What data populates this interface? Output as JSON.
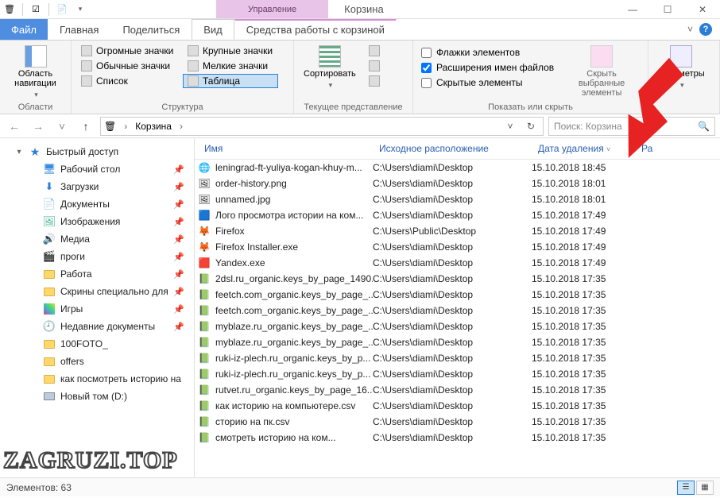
{
  "window": {
    "title": "Корзина",
    "context_tab_header": "Управление"
  },
  "file_tab": "Файл",
  "tabs": {
    "home": "Главная",
    "share": "Поделиться",
    "view": "Вид",
    "tool": "Средства работы с корзиной"
  },
  "ribbon": {
    "panes": {
      "label": "Области",
      "nav": "Область навигации"
    },
    "layout": {
      "label": "Структура",
      "huge": "Огромные значки",
      "large": "Крупные значки",
      "medium": "Обычные значки",
      "small": "Мелкие значки",
      "list": "Список",
      "details": "Таблица"
    },
    "current": {
      "label": "Текущее представление",
      "sort": "Сортировать"
    },
    "showhide": {
      "label": "Показать или скрыть",
      "checkboxes": "Флажки элементов",
      "extensions": "Расширения имен файлов",
      "hidden": "Скрытые элементы",
      "hideSelected": "Скрыть выбранные элементы"
    },
    "options": "Параметры"
  },
  "breadcrumb": {
    "root": "Корзина"
  },
  "search": {
    "placeholder": "Поиск: Корзина"
  },
  "sidebar": {
    "quick": "Быстрый доступ",
    "items": [
      {
        "label": "Рабочий стол",
        "icon": "desktop",
        "pin": true
      },
      {
        "label": "Загрузки",
        "icon": "down",
        "pin": true
      },
      {
        "label": "Документы",
        "icon": "doc",
        "pin": true
      },
      {
        "label": "Изображения",
        "icon": "img",
        "pin": true
      },
      {
        "label": "Медиа",
        "icon": "media",
        "pin": true
      },
      {
        "label": "проги",
        "icon": "film",
        "pin": true
      },
      {
        "label": "Работа",
        "icon": "folder",
        "pin": true
      },
      {
        "label": "Скрины специально для ",
        "icon": "folder",
        "pin": true
      },
      {
        "label": "Игры",
        "icon": "games",
        "pin": true
      },
      {
        "label": "Недавние документы",
        "icon": "clock",
        "pin": true
      },
      {
        "label": "100FOTO_",
        "icon": "folder",
        "pin": false
      },
      {
        "label": "offers",
        "icon": "folder",
        "pin": false
      },
      {
        "label": "как посмотреть историю на",
        "icon": "folder",
        "pin": false
      },
      {
        "label": "Новый том (D:)",
        "icon": "drive",
        "pin": false
      }
    ]
  },
  "columns": {
    "name": "Имя",
    "orig": "Исходное расположение",
    "date": "Дата удаления",
    "size": "Ра"
  },
  "files": [
    {
      "name": "leningrad-ft-yuliya-kogan-khuy-m...",
      "icon": "web",
      "orig": "C:\\Users\\diami\\Desktop",
      "date": "15.10.2018 18:45"
    },
    {
      "name": "order-history.png",
      "icon": "png",
      "orig": "C:\\Users\\diami\\Desktop",
      "date": "15.10.2018 18:01"
    },
    {
      "name": "unnamed.jpg",
      "icon": "png",
      "orig": "C:\\Users\\diami\\Desktop",
      "date": "15.10.2018 18:01"
    },
    {
      "name": "Лого просмотра истории на ком...",
      "icon": "psd",
      "orig": "C:\\Users\\diami\\Desktop",
      "date": "15.10.2018 17:49"
    },
    {
      "name": "Firefox",
      "icon": "ff",
      "orig": "C:\\Users\\Public\\Desktop",
      "date": "15.10.2018 17:49"
    },
    {
      "name": "Firefox Installer.exe",
      "icon": "ff",
      "orig": "C:\\Users\\diami\\Desktop",
      "date": "15.10.2018 17:49"
    },
    {
      "name": "Yandex.exe",
      "icon": "ya",
      "orig": "C:\\Users\\diami\\Desktop",
      "date": "15.10.2018 17:49"
    },
    {
      "name": "2dsl.ru_organic.keys_by_page_1490...",
      "icon": "xls",
      "orig": "C:\\Users\\diami\\Desktop",
      "date": "15.10.2018 17:35"
    },
    {
      "name": "feetch.com_organic.keys_by_page_...",
      "icon": "xls",
      "orig": "C:\\Users\\diami\\Desktop",
      "date": "15.10.2018 17:35"
    },
    {
      "name": "feetch.com_organic.keys_by_page_...",
      "icon": "xls",
      "orig": "C:\\Users\\diami\\Desktop",
      "date": "15.10.2018 17:35"
    },
    {
      "name": "myblaze.ru_organic.keys_by_page_...",
      "icon": "xls",
      "orig": "C:\\Users\\diami\\Desktop",
      "date": "15.10.2018 17:35"
    },
    {
      "name": "myblaze.ru_organic.keys_by_page_...",
      "icon": "xls",
      "orig": "C:\\Users\\diami\\Desktop",
      "date": "15.10.2018 17:35"
    },
    {
      "name": "ruki-iz-plech.ru_organic.keys_by_p...",
      "icon": "xls",
      "orig": "C:\\Users\\diami\\Desktop",
      "date": "15.10.2018 17:35"
    },
    {
      "name": "ruki-iz-plech.ru_organic.keys_by_p...",
      "icon": "xls",
      "orig": "C:\\Users\\diami\\Desktop",
      "date": "15.10.2018 17:35"
    },
    {
      "name": "rutvet.ru_organic.keys_by_page_16...",
      "icon": "xls",
      "orig": "C:\\Users\\diami\\Desktop",
      "date": "15.10.2018 17:35"
    },
    {
      "name": "как историю на компьютере.csv",
      "icon": "xls",
      "orig": "C:\\Users\\diami\\Desktop",
      "date": "15.10.2018 17:35"
    },
    {
      "name": "сторию на пк.csv",
      "icon": "xls",
      "orig": "C:\\Users\\diami\\Desktop",
      "date": "15.10.2018 17:35"
    },
    {
      "name": "смотреть историю на ком...",
      "icon": "xls",
      "orig": "C:\\Users\\diami\\Desktop",
      "date": "15.10.2018 17:35"
    }
  ],
  "status": {
    "count_label": "Элементов: 63"
  },
  "watermark": "ZAGRUZI.TOP"
}
